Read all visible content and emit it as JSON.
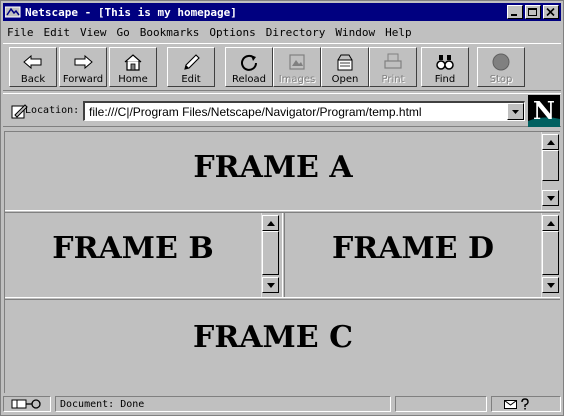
{
  "window": {
    "title": "Netscape - [This is my homepage]"
  },
  "menu": [
    "File",
    "Edit",
    "View",
    "Go",
    "Bookmarks",
    "Options",
    "Directory",
    "Window",
    "Help"
  ],
  "toolbar": [
    {
      "label": "Back",
      "icon": "back-arrow-icon",
      "enabled": true
    },
    {
      "label": "Forward",
      "icon": "forward-arrow-icon",
      "enabled": true
    },
    {
      "label": "Home",
      "icon": "home-icon",
      "enabled": true
    },
    {
      "label": "Edit",
      "icon": "pencil-icon",
      "enabled": true
    },
    {
      "label": "Reload",
      "icon": "reload-icon",
      "enabled": true
    },
    {
      "label": "Images",
      "icon": "images-icon",
      "enabled": false
    },
    {
      "label": "Open",
      "icon": "open-icon",
      "enabled": true
    },
    {
      "label": "Print",
      "icon": "printer-icon",
      "enabled": false
    },
    {
      "label": "Find",
      "icon": "binoculars-icon",
      "enabled": true
    },
    {
      "label": "Stop",
      "icon": "stop-icon",
      "enabled": false
    }
  ],
  "location": {
    "label": "Location:",
    "url": "file:///C|/Program Files/Netscape/Navigator/Program/temp.html"
  },
  "frames": {
    "a": "FRAME A",
    "b": "FRAME B",
    "c": "FRAME C",
    "d": "FRAME D"
  },
  "status": {
    "text": "Document: Done"
  },
  "colors": {
    "titlebar": "#000080",
    "chrome": "#c0c0c0"
  }
}
